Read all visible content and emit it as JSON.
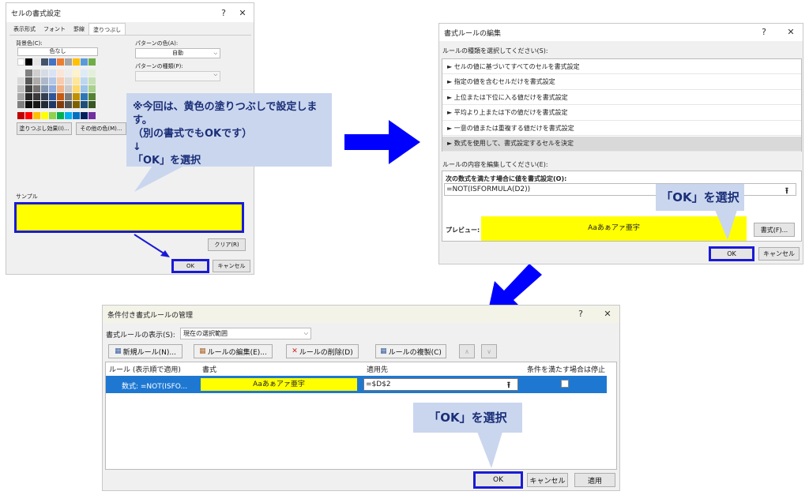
{
  "d1": {
    "title": "セルの書式設定",
    "help": "?",
    "close": "✕",
    "tabs": [
      "表示形式",
      "フォント",
      "罫線",
      "塗りつぶし"
    ],
    "bg_label": "背景色(C):",
    "no_color": "色なし",
    "pattern_color_label": "パターンの色(A):",
    "pattern_color_value": "自動",
    "pattern_type_label": "パターンの種類(P):",
    "fill_effects_btn": "塗りつぶし効果(I)...",
    "more_colors_btn": "その他の色(M)...",
    "sample_label": "サンプル",
    "sample_color": "#ffff00",
    "clear_btn": "クリア(R)",
    "ok_btn": "OK",
    "cancel_btn": "キャンセル",
    "palette": [
      [
        "#ffffff",
        "#000000",
        "#e7e6e6",
        "#44546a",
        "#4472c4",
        "#ed7d31",
        "#a5a5a5",
        "#ffc000",
        "#5b9bd5",
        "#70ad47"
      ],
      [
        "#f2f2f2",
        "#808080",
        "#d0cece",
        "#d6dce5",
        "#dae3f3",
        "#fbe5d6",
        "#ededed",
        "#fff2cc",
        "#deebf7",
        "#e2f0d9"
      ],
      [
        "#d9d9d9",
        "#595959",
        "#aeabab",
        "#adb9ca",
        "#b4c7e7",
        "#f8cbad",
        "#dbdbdb",
        "#ffe699",
        "#bdd7ee",
        "#c5e0b4"
      ],
      [
        "#bfbfbf",
        "#404040",
        "#757171",
        "#8497b0",
        "#8faadc",
        "#f4b183",
        "#c9c9c9",
        "#ffd966",
        "#9dc3e6",
        "#a9d18e"
      ],
      [
        "#a6a6a6",
        "#262626",
        "#3a3838",
        "#333f50",
        "#2f5597",
        "#c55a11",
        "#7b7b7b",
        "#bf9000",
        "#2e75b6",
        "#548235"
      ],
      [
        "#7f7f7f",
        "#0d0d0d",
        "#171717",
        "#222a35",
        "#203864",
        "#843c0c",
        "#525252",
        "#7f6000",
        "#1f4e79",
        "#385723"
      ],
      [
        "#c00000",
        "#ff0000",
        "#ffc000",
        "#ffff00",
        "#92d050",
        "#00b050",
        "#00b0f0",
        "#0070c0",
        "#002060",
        "#7030a0"
      ]
    ]
  },
  "callout1": {
    "line1": "※今回は、黄色の塗りつぶしで設定します。",
    "line2": "（別の書式でもOKです）",
    "line3": "↓",
    "line4": "「OK」を選択"
  },
  "d2": {
    "title": "書式ルールの編集",
    "help": "?",
    "close": "✕",
    "rule_type_label": "ルールの種類を選択してください(S):",
    "rule_types": [
      "► セルの値に基づいてすべてのセルを書式設定",
      "► 指定の値を含むセルだけを書式設定",
      "► 上位または下位に入る値だけを書式設定",
      "► 平均より上または下の値だけを書式設定",
      "► 一意の値または重複する値だけを書式設定",
      "► 数式を使用して、書式設定するセルを決定"
    ],
    "edit_label": "ルールの内容を編集してください(E):",
    "formula_label": "次の数式を満たす場合に値を書式設定(O):",
    "formula_value": "=NOT(ISFORMULA(D2))",
    "preview_label": "プレビュー:",
    "preview_text": "Aaあぁアァ亜宇",
    "format_btn": "書式(F)...",
    "ok_btn": "OK",
    "cancel_btn": "キャンセル"
  },
  "callout2": {
    "text": "「OK」を選択"
  },
  "d3": {
    "title": "条件付き書式ルールの管理",
    "help": "?",
    "close": "✕",
    "show_label": "書式ルールの表示(S):",
    "show_value": "現在の選択範囲",
    "toolbar": [
      "新規ルール(N)...",
      "ルールの編集(E)...",
      "ルールの削除(D)",
      "ルールの複製(C)"
    ],
    "headers": [
      "ルール (表示順で適用)",
      "書式",
      "適用先",
      "条件を満たす場合は停止"
    ],
    "row": {
      "rule": "数式: =NOT(ISFO...",
      "format": "Aaあぁアァ亜宇",
      "applies": "=$D$2"
    },
    "ok_btn": "OK",
    "cancel_btn": "キャンセル",
    "apply_btn": "適用"
  },
  "callout3": {
    "text": "「OK」を選択"
  },
  "colors": {
    "accent": "#1a1ad6",
    "callout_bg": "#cad6ee",
    "callout_text": "#1a2e78",
    "selection": "#1e78d2",
    "preview": "#ffff00"
  }
}
